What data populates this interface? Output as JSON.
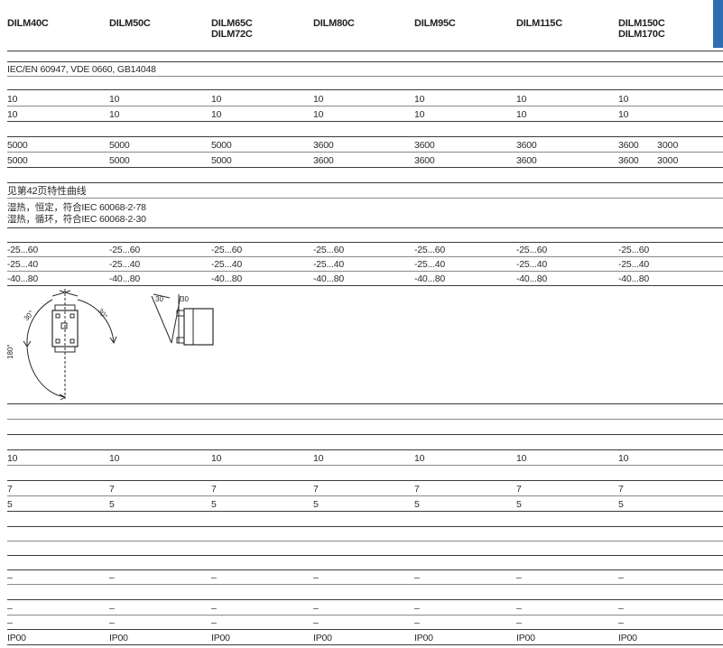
{
  "header": {
    "columns": [
      {
        "line1": "DILM40C",
        "line2": ""
      },
      {
        "line1": "DILM50C",
        "line2": ""
      },
      {
        "line1": "DILM65C",
        "line2": "DILM72C"
      },
      {
        "line1": "DILM80C",
        "line2": ""
      },
      {
        "line1": "DILM95C",
        "line2": ""
      },
      {
        "line1": "DILM115C",
        "line2": ""
      },
      {
        "line1": "DILM150C",
        "line2": "DILM170C"
      }
    ],
    "accent_color": "#2f6db3"
  },
  "standards": "IEC/EN 60947, VDE 0660, GB14048",
  "rows": [
    {
      "id": "r10a",
      "values": [
        "10",
        "10",
        "10",
        "10",
        "10",
        "10",
        "10"
      ],
      "extra": ""
    },
    {
      "id": "r10b",
      "values": [
        "10",
        "10",
        "10",
        "10",
        "10",
        "10",
        "10"
      ],
      "extra": ""
    },
    {
      "id": "r5000a",
      "values": [
        "5000",
        "5000",
        "5000",
        "3600",
        "3600",
        "3600",
        "3600"
      ],
      "extra": "3000"
    },
    {
      "id": "r5000b",
      "values": [
        "5000",
        "5000",
        "5000",
        "3600",
        "3600",
        "3600",
        "3600"
      ],
      "extra": "3000"
    },
    {
      "id": "t1",
      "values": [
        "-25...60",
        "-25...60",
        "-25...60",
        "-25...60",
        "-25...60",
        "-25...60",
        "-25...60"
      ],
      "extra": ""
    },
    {
      "id": "t2",
      "values": [
        "-25...40",
        "-25...40",
        "-25...40",
        "-25...40",
        "-25...40",
        "-25...40",
        "-25...40"
      ],
      "extra": ""
    },
    {
      "id": "t3",
      "values": [
        "-40...80",
        "-40...80",
        "-40...80",
        "-40...80",
        "-40...80",
        "-40...80",
        "-40...80"
      ],
      "extra": ""
    },
    {
      "id": "s10",
      "values": [
        "10",
        "10",
        "10",
        "10",
        "10",
        "10",
        "10"
      ],
      "extra": ""
    },
    {
      "id": "s7",
      "values": [
        "7",
        "7",
        "7",
        "7",
        "7",
        "7",
        "7"
      ],
      "extra": ""
    },
    {
      "id": "s5",
      "values": [
        "5",
        "5",
        "5",
        "5",
        "5",
        "5",
        "5"
      ],
      "extra": ""
    },
    {
      "id": "d1",
      "values": [
        "–",
        "–",
        "–",
        "–",
        "–",
        "–",
        "–"
      ],
      "extra": ""
    },
    {
      "id": "d2",
      "values": [
        "–",
        "–",
        "–",
        "–",
        "–",
        "–",
        "–"
      ],
      "extra": ""
    },
    {
      "id": "d3",
      "values": [
        "–",
        "–",
        "–",
        "–",
        "–",
        "–",
        "–"
      ],
      "extra": ""
    },
    {
      "id": "ip",
      "values": [
        "IP00",
        "IP00",
        "IP00",
        "IP00",
        "IP00",
        "IP00",
        "IP00"
      ],
      "extra": ""
    }
  ],
  "notes": {
    "curve_ref": "见第42页特性曲线",
    "climate1": "湿热，恒定，符合IEC 60068-2-78",
    "climate2": "湿热，循环，符合IEC 60068-2-30"
  },
  "diagram": {
    "angle_top_left": "30°",
    "angle_top_right": "30°",
    "angle_side": "180°",
    "dim_left": "30",
    "dim_right": "30"
  }
}
